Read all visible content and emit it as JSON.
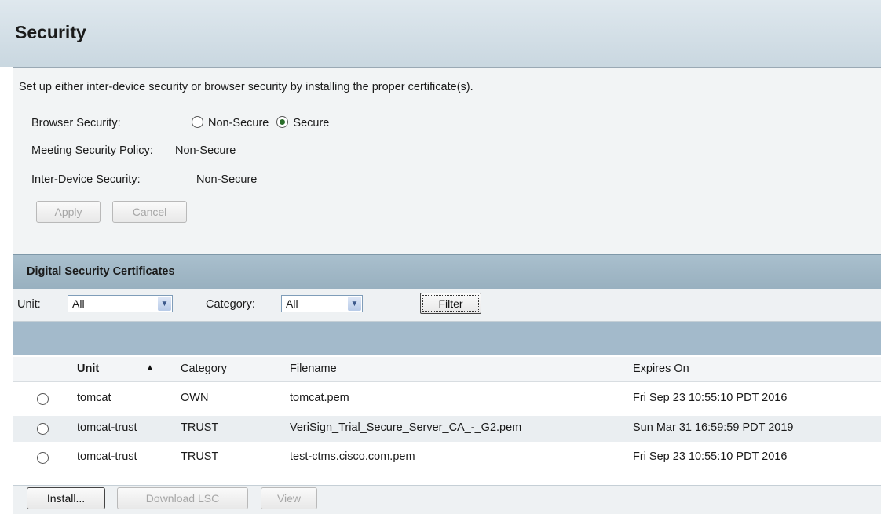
{
  "page": {
    "title": "Security"
  },
  "settings": {
    "intro": "Set up either inter-device security or browser security by installing the proper certificate(s).",
    "browser_security_label": "Browser Security:",
    "browser_security_options": [
      "Non-Secure",
      "Secure"
    ],
    "browser_security_selected": "Secure",
    "meeting_policy_label": "Meeting Security Policy:",
    "meeting_policy_value": "Non-Secure",
    "inter_device_label": "Inter-Device Security:",
    "inter_device_value": "Non-Secure",
    "apply_label": "Apply",
    "cancel_label": "Cancel"
  },
  "certificates": {
    "section_title": "Digital Security Certificates",
    "filter": {
      "unit_label": "Unit:",
      "unit_value": "All",
      "category_label": "Category:",
      "category_value": "All",
      "filter_button": "Filter"
    },
    "columns": [
      "Unit",
      "Category",
      "Filename",
      "Expires On"
    ],
    "sort_column": "Unit",
    "sort_direction": "ascending",
    "rows": [
      {
        "unit": "tomcat",
        "category": "OWN",
        "filename": "tomcat.pem",
        "expires": "Fri Sep 23 10:55:10 PDT 2016"
      },
      {
        "unit": "tomcat-trust",
        "category": "TRUST",
        "filename": "VeriSign_Trial_Secure_Server_CA_-_G2.pem",
        "expires": "Sun Mar 31 16:59:59 PDT 2019"
      },
      {
        "unit": "tomcat-trust",
        "category": "TRUST",
        "filename": "test-ctms.cisco.com.pem",
        "expires": "Fri Sep 23 10:55:10 PDT 2016"
      }
    ],
    "actions": {
      "install_label": "Install...",
      "download_label": "Download LSC",
      "view_label": "View"
    }
  }
}
